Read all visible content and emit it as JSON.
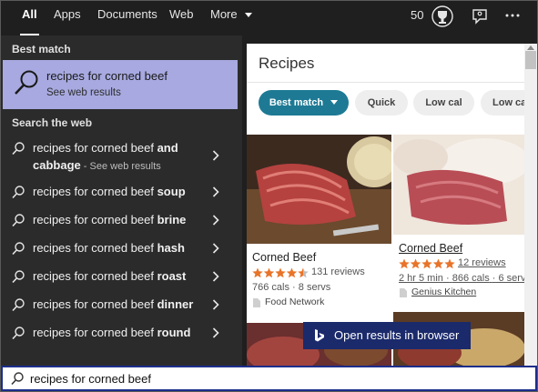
{
  "tabs": [
    "All",
    "Apps",
    "Documents",
    "Web",
    "More"
  ],
  "rewards_points": "50",
  "left": {
    "best_match_heading": "Best match",
    "best_match_title": "recipes for corned beef",
    "best_match_sub": "See web results",
    "search_web_heading": "Search the web",
    "suggestions": [
      {
        "prefix": "recipes for corned beef ",
        "bold": "and",
        "line2_bold": "cabbage",
        "line2_suffix": " - See web results"
      },
      {
        "prefix": "recipes for corned beef ",
        "bold": "soup"
      },
      {
        "prefix": "recipes for corned beef ",
        "bold": "brine"
      },
      {
        "prefix": "recipes for corned beef ",
        "bold": "hash"
      },
      {
        "prefix": "recipes for corned beef ",
        "bold": "roast"
      },
      {
        "prefix": "recipes for corned beef ",
        "bold": "dinner"
      },
      {
        "prefix": "recipes for corned beef ",
        "bold": "round"
      }
    ]
  },
  "recipes": {
    "title": "Recipes",
    "pills": [
      "Best match",
      "Quick",
      "Low cal",
      "Low ca"
    ],
    "cards": [
      {
        "name": "Corned Beef",
        "reviews": "131 reviews",
        "rating": 4.5,
        "cals": "766 cals",
        "dot": "·",
        "servs": "8 servs",
        "source": "Food Network"
      },
      {
        "name": "Corned Beef",
        "reviews": "12 reviews",
        "rating": 5,
        "time": "2 hr 5 min",
        "cals": "866 cals",
        "dot": "·",
        "servs": "6 servs",
        "source": "Genius Kitchen"
      }
    ],
    "open_button": "Open results in browser"
  },
  "search": {
    "query": "recipes for corned beef"
  },
  "colors": {
    "accent": "#1e7a94",
    "best_match_bg": "#a7a9e0",
    "star": "#e8742a",
    "open_btn": "#1b2a6b"
  }
}
